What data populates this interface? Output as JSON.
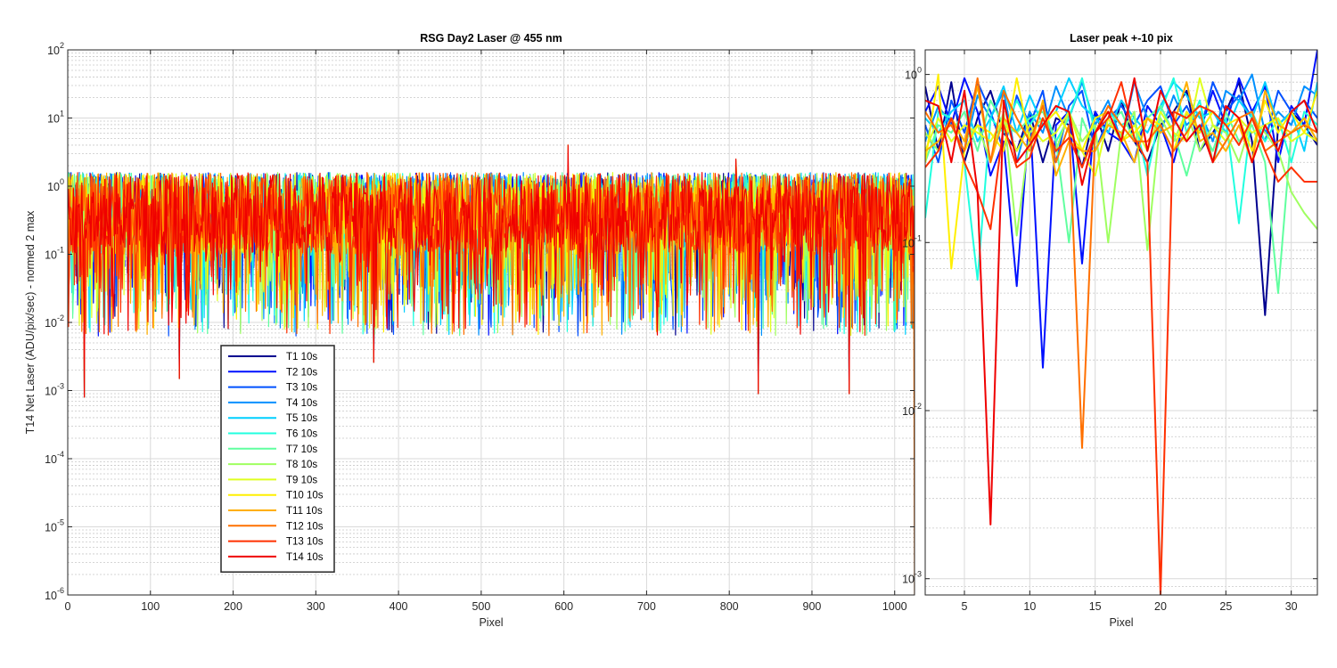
{
  "chart_data": [
    {
      "type": "line",
      "title": "RSG  Day2 Laser @ 455 nm",
      "xlabel": "Pixel",
      "ylabel": "T14 Net Laser (ADU/pix/sec) - normed 2 max",
      "xlim": [
        0,
        1024
      ],
      "ylim": [
        1e-06,
        100
      ],
      "yscale": "log",
      "grid": true,
      "minor_grid": true,
      "legend_position": "lower-left",
      "xticks": [
        0,
        100,
        200,
        300,
        400,
        500,
        600,
        700,
        800,
        900,
        1000
      ],
      "yticks": [
        {
          "value": 1e-06,
          "base": "10",
          "exp": "-6"
        },
        {
          "value": 1e-05,
          "base": "10",
          "exp": "-5"
        },
        {
          "value": 0.0001,
          "base": "10",
          "exp": "-4"
        },
        {
          "value": 0.001,
          "base": "10",
          "exp": "-3"
        },
        {
          "value": 0.01,
          "base": "10",
          "exp": "-2"
        },
        {
          "value": 0.1,
          "base": "10",
          "exp": "-1"
        },
        {
          "value": 1,
          "base": "10",
          "exp": "0"
        },
        {
          "value": 10,
          "base": "10",
          "exp": "1"
        },
        {
          "value": 100,
          "base": "10",
          "exp": "2"
        }
      ],
      "series": [
        {
          "name": "T1 10s",
          "color": "#00008F"
        },
        {
          "name": "T2 10s",
          "color": "#0010FF"
        },
        {
          "name": "T3 10s",
          "color": "#0050FF"
        },
        {
          "name": "T4 10s",
          "color": "#0090FF"
        },
        {
          "name": "T5 10s",
          "color": "#00CFFF"
        },
        {
          "name": "T6 10s",
          "color": "#20FFDF"
        },
        {
          "name": "T7 10s",
          "color": "#60FF9F"
        },
        {
          "name": "T8 10s",
          "color": "#9FFF60"
        },
        {
          "name": "T9 10s",
          "color": "#DFFF20"
        },
        {
          "name": "T10 10s",
          "color": "#FFEF00"
        },
        {
          "name": "T11 10s",
          "color": "#FFAF00"
        },
        {
          "name": "T12 10s",
          "color": "#FF7000"
        },
        {
          "name": "T13 10s",
          "color": "#FF3000"
        },
        {
          "name": "T14 10s",
          "color": "#EF0000"
        }
      ],
      "notable_points": [
        {
          "x": 20,
          "y": 0.0008
        },
        {
          "x": 135,
          "y": 0.0015
        },
        {
          "x": 370,
          "y": 0.0026
        },
        {
          "x": 605,
          "y": 4.0
        },
        {
          "x": 808,
          "y": 2.5
        },
        {
          "x": 835,
          "y": 0.0009
        },
        {
          "x": 945,
          "y": 0.0009
        }
      ]
    },
    {
      "type": "line",
      "title": "Laser peak +-10 pix",
      "xlabel": "Pixel",
      "ylabel": "",
      "xlim": [
        2,
        32
      ],
      "ylim": [
        0.0008,
        1.4
      ],
      "yscale": "log",
      "grid": true,
      "minor_grid": true,
      "xticks": [
        5,
        10,
        15,
        20,
        25,
        30
      ],
      "yticks": [
        {
          "value": 0.001,
          "base": "10",
          "exp": "-3"
        },
        {
          "value": 0.01,
          "base": "10",
          "exp": "-2"
        },
        {
          "value": 0.1,
          "base": "10",
          "exp": "-1"
        },
        {
          "value": 1,
          "base": "10",
          "exp": "0"
        }
      ],
      "x": [
        2,
        3,
        4,
        5,
        6,
        7,
        8,
        9,
        10,
        11,
        12,
        13,
        14,
        15,
        16,
        17,
        18,
        19,
        20,
        21,
        22,
        23,
        24,
        25,
        26,
        27,
        28,
        29,
        30,
        31,
        32
      ],
      "series": [
        {
          "name": "T1 10s",
          "color": "#00008F",
          "values": [
            0.85,
            0.35,
            0.9,
            0.3,
            0.55,
            0.8,
            0.45,
            0.35,
            0.6,
            0.3,
            0.55,
            0.5,
            0.28,
            0.6,
            0.35,
            0.7,
            0.4,
            0.3,
            0.5,
            0.6,
            0.8,
            0.35,
            0.45,
            0.6,
            0.9,
            0.4,
            0.037,
            0.5,
            0.6,
            0.5,
            0.38
          ]
        },
        {
          "name": "T2 10s",
          "color": "#0010FF",
          "values": [
            0.6,
            0.85,
            0.5,
            0.95,
            0.6,
            0.25,
            0.4,
            0.055,
            0.6,
            0.018,
            0.5,
            0.6,
            0.075,
            0.6,
            0.45,
            0.4,
            0.3,
            0.65,
            0.5,
            0.3,
            0.6,
            0.45,
            0.8,
            0.5,
            0.95,
            0.6,
            0.85,
            0.3,
            0.65,
            0.5,
            1.4
          ]
        },
        {
          "name": "T3 10s",
          "color": "#0050FF",
          "values": [
            0.5,
            0.3,
            0.7,
            0.45,
            0.9,
            0.6,
            0.35,
            0.75,
            0.5,
            0.8,
            0.3,
            0.65,
            0.8,
            0.35,
            0.55,
            0.65,
            0.5,
            0.7,
            0.85,
            0.5,
            0.65,
            0.45,
            0.9,
            0.6,
            0.75,
            0.55,
            0.4,
            0.8,
            0.6,
            0.7,
            0.55
          ]
        },
        {
          "name": "T4 10s",
          "color": "#0090FF",
          "values": [
            0.4,
            0.65,
            0.5,
            0.35,
            0.75,
            0.55,
            0.8,
            0.3,
            0.6,
            0.45,
            0.85,
            0.55,
            0.9,
            0.5,
            0.7,
            0.4,
            0.9,
            0.55,
            0.45,
            0.75,
            0.5,
            0.6,
            0.4,
            0.8,
            0.7,
            1.0,
            0.45,
            0.6,
            0.5,
            0.85,
            0.75
          ]
        },
        {
          "name": "T5 10s",
          "color": "#00CFFF",
          "values": [
            0.55,
            0.45,
            0.6,
            0.7,
            0.4,
            0.55,
            0.85,
            0.45,
            0.75,
            0.5,
            0.6,
            0.95,
            0.65,
            0.55,
            0.45,
            0.7,
            0.55,
            0.45,
            0.65,
            0.9,
            0.75,
            0.55,
            0.6,
            0.45,
            0.7,
            0.55,
            0.9,
            0.5,
            0.6,
            0.35,
            0.9
          ]
        },
        {
          "name": "T6 10s",
          "color": "#20FFDF",
          "values": [
            0.14,
            0.6,
            0.55,
            0.3,
            0.06,
            0.55,
            0.45,
            0.7,
            0.5,
            0.65,
            0.4,
            0.55,
            0.95,
            0.45,
            0.6,
            0.5,
            0.55,
            0.25,
            0.6,
            0.95,
            0.45,
            0.7,
            0.3,
            0.55,
            0.13,
            0.6,
            0.4,
            0.55,
            0.3,
            0.6,
            0.5
          ]
        },
        {
          "name": "T7 10s",
          "color": "#60FF9F",
          "values": [
            0.3,
            0.5,
            0.45,
            0.6,
            0.35,
            0.7,
            0.5,
            0.45,
            0.55,
            0.6,
            0.4,
            0.1,
            0.55,
            0.35,
            0.5,
            0.6,
            0.4,
            0.55,
            0.65,
            0.45,
            0.25,
            0.5,
            0.35,
            0.6,
            0.4,
            0.5,
            0.3,
            0.05,
            0.45,
            0.55,
            0.4
          ]
        },
        {
          "name": "T8 10s",
          "color": "#9FFF60",
          "values": [
            0.45,
            0.35,
            0.55,
            0.4,
            0.5,
            0.3,
            0.6,
            0.11,
            0.45,
            0.55,
            0.35,
            0.6,
            0.4,
            0.5,
            0.1,
            0.45,
            0.6,
            0.09,
            0.55,
            0.4,
            0.6,
            0.35,
            0.5,
            0.45,
            0.3,
            0.55,
            0.45,
            0.35,
            0.2,
            0.15,
            0.12
          ]
        },
        {
          "name": "T9 10s",
          "color": "#DFFF20",
          "values": [
            0.35,
            0.55,
            0.4,
            0.5,
            0.45,
            0.4,
            0.55,
            0.35,
            0.5,
            0.4,
            0.45,
            0.6,
            0.35,
            0.25,
            0.55,
            0.4,
            0.5,
            0.35,
            0.6,
            0.45,
            0.4,
            0.95,
            0.5,
            0.4,
            0.55,
            0.45,
            0.5,
            0.55,
            0.4,
            0.45,
            0.4
          ]
        },
        {
          "name": "T10 10s",
          "color": "#FFEF00",
          "values": [
            0.3,
            1.0,
            0.07,
            0.35,
            0.5,
            0.45,
            0.35,
            0.95,
            0.4,
            0.5,
            0.6,
            0.45,
            0.35,
            0.55,
            0.6,
            0.4,
            0.45,
            0.55,
            0.5,
            0.35,
            0.6,
            0.45,
            0.6,
            0.5,
            0.55,
            0.35,
            0.7,
            0.45,
            0.6,
            0.45,
            0.8
          ]
        },
        {
          "name": "T11 10s",
          "color": "#FFAF00",
          "values": [
            0.35,
            0.4,
            0.55,
            0.4,
            0.85,
            0.3,
            0.55,
            0.45,
            0.35,
            0.7,
            0.25,
            0.4,
            0.35,
            0.35,
            0.5,
            0.45,
            0.3,
            0.55,
            0.45,
            0.5,
            0.9,
            0.4,
            0.45,
            0.35,
            0.5,
            0.3,
            0.8,
            0.5,
            0.45,
            0.55,
            0.4
          ]
        },
        {
          "name": "T12 10s",
          "color": "#FF7000",
          "values": [
            0.6,
            0.45,
            0.5,
            0.35,
            0.95,
            0.3,
            0.8,
            0.55,
            0.4,
            0.65,
            0.3,
            0.5,
            0.006,
            0.45,
            0.65,
            0.5,
            0.4,
            0.4,
            0.5,
            0.35,
            0.45,
            0.6,
            0.3,
            0.4,
            0.55,
            0.6,
            0.35,
            0.4,
            0.45,
            0.5,
            0.45
          ]
        },
        {
          "name": "T13 10s",
          "color": "#FF3000",
          "values": [
            0.28,
            0.35,
            0.55,
            0.3,
            0.2,
            0.12,
            0.5,
            0.28,
            0.32,
            0.55,
            0.35,
            0.42,
            0.28,
            0.45,
            0.55,
            0.9,
            0.42,
            0.3,
            0.0008,
            0.6,
            0.55,
            0.65,
            0.6,
            0.5,
            0.38,
            0.55,
            0.35,
            0.23,
            0.28,
            0.23,
            0.23
          ]
        },
        {
          "name": "T14 10s",
          "color": "#EF0000",
          "values": [
            0.7,
            0.65,
            0.3,
            0.8,
            0.2,
            0.0021,
            0.7,
            0.3,
            0.38,
            0.5,
            0.65,
            0.6,
            0.22,
            0.45,
            0.6,
            0.4,
            0.95,
            0.35,
            0.8,
            0.55,
            0.4,
            0.5,
            0.3,
            0.65,
            0.55,
            0.3,
            0.5,
            0.35,
            0.6,
            0.7,
            0.45
          ]
        }
      ]
    }
  ]
}
